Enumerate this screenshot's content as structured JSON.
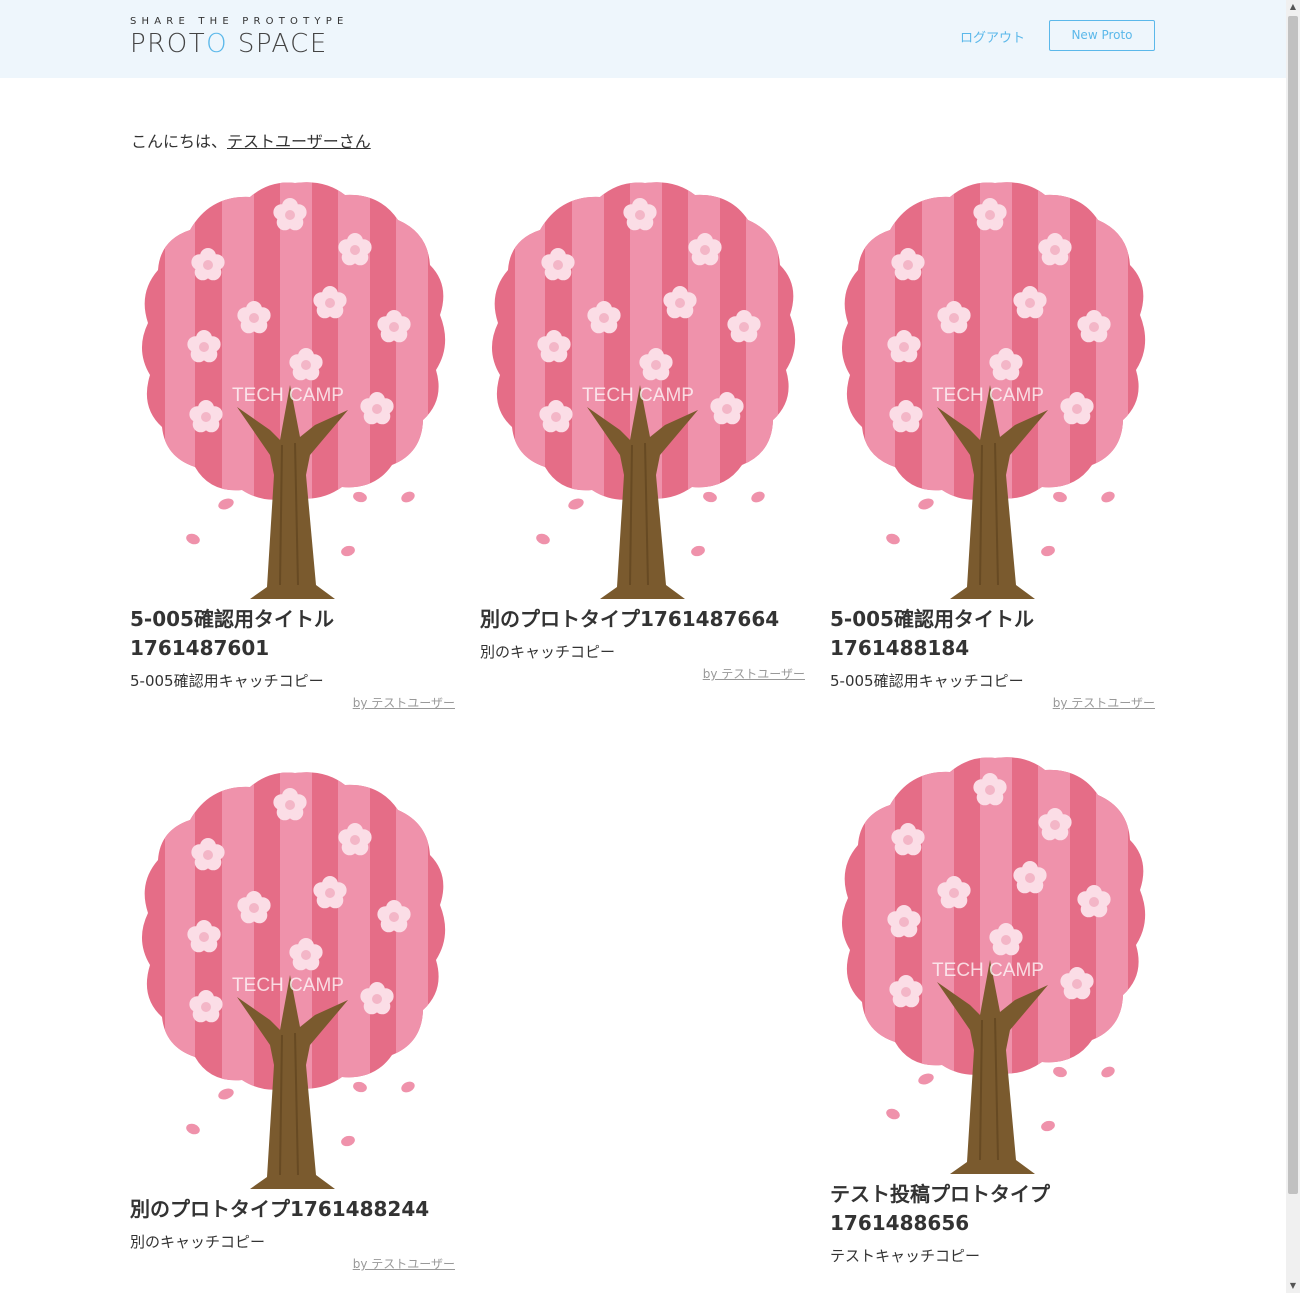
{
  "header": {
    "logo_tagline": "SHARE THE PROTOTYPE",
    "logo_name_part1": "PROT",
    "logo_name_o": "O",
    "logo_name_part2": " SPACE",
    "logout_label": "ログアウト",
    "new_proto_label": "New Proto"
  },
  "greeting": {
    "prefix": "こんにちは、",
    "user_link": "テストユーザーさん"
  },
  "image_watermark": "TECH CAMP",
  "prototypes": [
    {
      "title": "5-005確認用タイトル1761487601",
      "catch_copy": "5-005確認用キャッチコピー",
      "by": "by テストユーザー"
    },
    {
      "title": "別のプロトタイプ1761487664",
      "catch_copy": "別のキャッチコピー",
      "by": "by テストユーザー"
    },
    {
      "title": "5-005確認用タイトル1761488184",
      "catch_copy": "5-005確認用キャッチコピー",
      "by": "by テストユーザー"
    },
    {
      "title": "別のプロトタイプ1761488244",
      "catch_copy": "別のキャッチコピー",
      "by": "by テストユーザー"
    },
    {
      "title": "テスト投稿プロトタイプ1761488656",
      "catch_copy": "テストキャッチコピー",
      "by": "by テストユーザー"
    }
  ],
  "colors": {
    "header_bg": "#eef6fc",
    "accent": "#5bb8ea",
    "blossom_dark": "#e56d87",
    "blossom_light": "#ef92ab",
    "flower": "#fbdde6",
    "trunk": "#7a5a2e"
  }
}
